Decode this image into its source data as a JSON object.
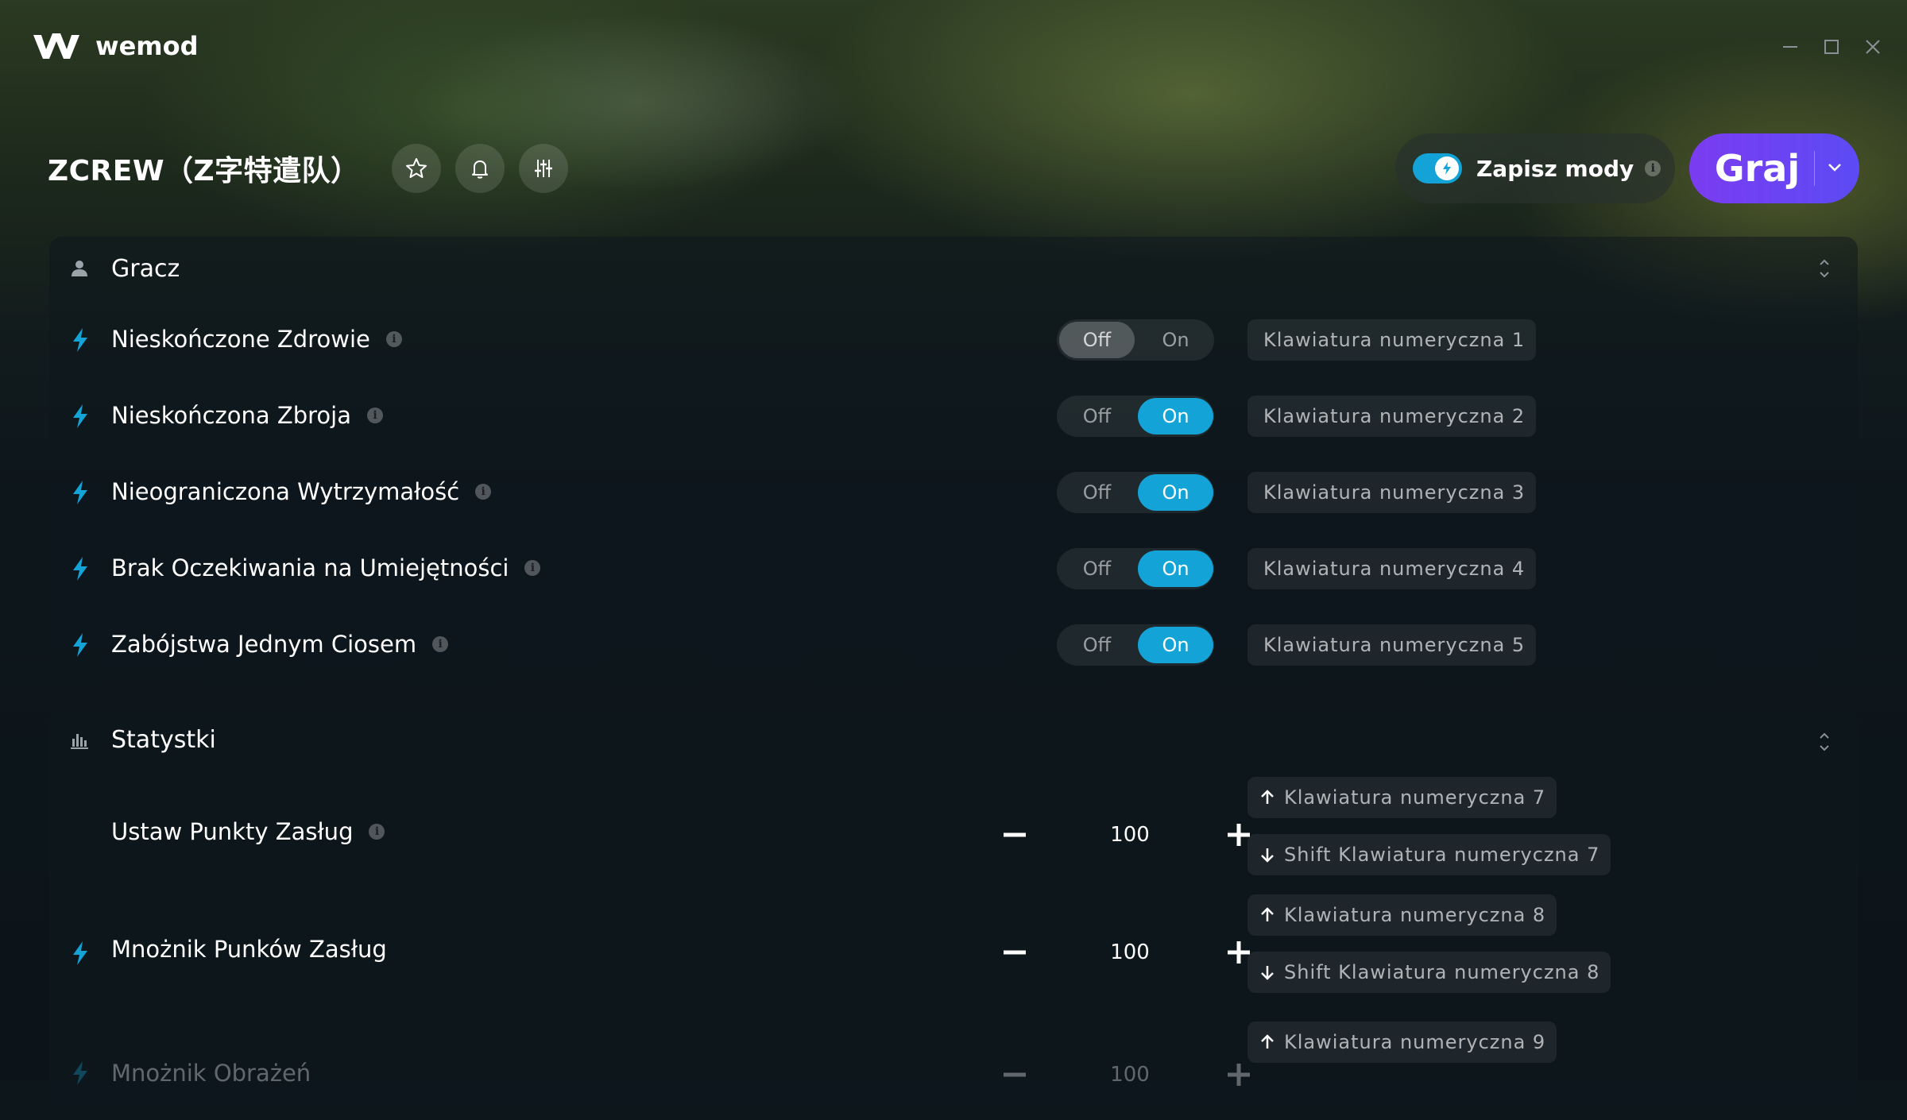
{
  "app": {
    "name": "wemod"
  },
  "game": {
    "title": "ZCREW（Z字特遣队）"
  },
  "header": {
    "save_mods_label": "Zapisz mody",
    "info_glyph": "i",
    "play_label": "Graj"
  },
  "colors": {
    "accent": "#13a3d6",
    "play": "#6a44f2",
    "background": "#0d161b"
  },
  "sections": [
    {
      "title": "Gracz",
      "icon": "user-icon",
      "rows": [
        {
          "label": "Nieskończone Zdrowie",
          "off_label": "Off",
          "on_label": "On",
          "state": "off",
          "hotkey": "Klawiatura numeryczna 1"
        },
        {
          "label": "Nieskończona Zbroja",
          "off_label": "Off",
          "on_label": "On",
          "state": "on",
          "hotkey": "Klawiatura numeryczna 2"
        },
        {
          "label": "Nieograniczona Wytrzymałość",
          "off_label": "Off",
          "on_label": "On",
          "state": "on",
          "hotkey": "Klawiatura numeryczna 3"
        },
        {
          "label": "Brak Oczekiwania na Umiejętności",
          "off_label": "Off",
          "on_label": "On",
          "state": "on",
          "hotkey": "Klawiatura numeryczna 4"
        },
        {
          "label": "Zabójstwa Jednym Ciosem",
          "off_label": "Off",
          "on_label": "On",
          "state": "on",
          "hotkey": "Klawiatura numeryczna 5"
        }
      ]
    },
    {
      "title": "Statystki",
      "icon": "bar-chart-icon",
      "rows": [
        {
          "label": "Ustaw Punkty Zasług",
          "value": "100",
          "hotkey_up": "Klawiatura numeryczna 7",
          "hotkey_down": "Shift Klawiatura numeryczna 7"
        },
        {
          "label": "Mnożnik Punków Zasług",
          "value": "100",
          "hotkey_up": "Klawiatura numeryczna 8",
          "hotkey_down": "Shift Klawiatura numeryczna 8"
        },
        {
          "label": "Mnożnik Obrażeń",
          "value": "100",
          "hotkey_up": "Klawiatura numeryczna 9"
        }
      ]
    }
  ]
}
